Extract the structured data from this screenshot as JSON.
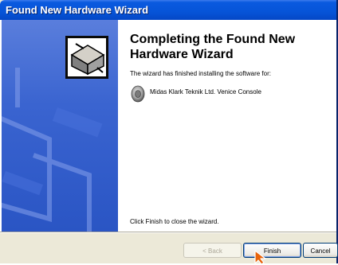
{
  "window": {
    "title": "Found New Hardware Wizard"
  },
  "wizard": {
    "heading": "Completing the Found New Hardware Wizard",
    "status_text": "The wizard has finished installing the software for:",
    "device_name": "Midas Klark Teknik Ltd. Venice Console",
    "finish_hint": "Click Finish to close the wizard."
  },
  "buttons": {
    "back_label": "< Back",
    "finish_label": "Finish",
    "cancel_label": "Cancel"
  },
  "icons": {
    "banner": "hardware-wizard-icon",
    "device": "speaker-icon",
    "cursor": "mouse-pointer-icon"
  },
  "colors": {
    "titlebar": "#0654d8",
    "banner": "#3a64d0",
    "dialog_background": "#ece9d8",
    "cursor": "#e8640c"
  }
}
